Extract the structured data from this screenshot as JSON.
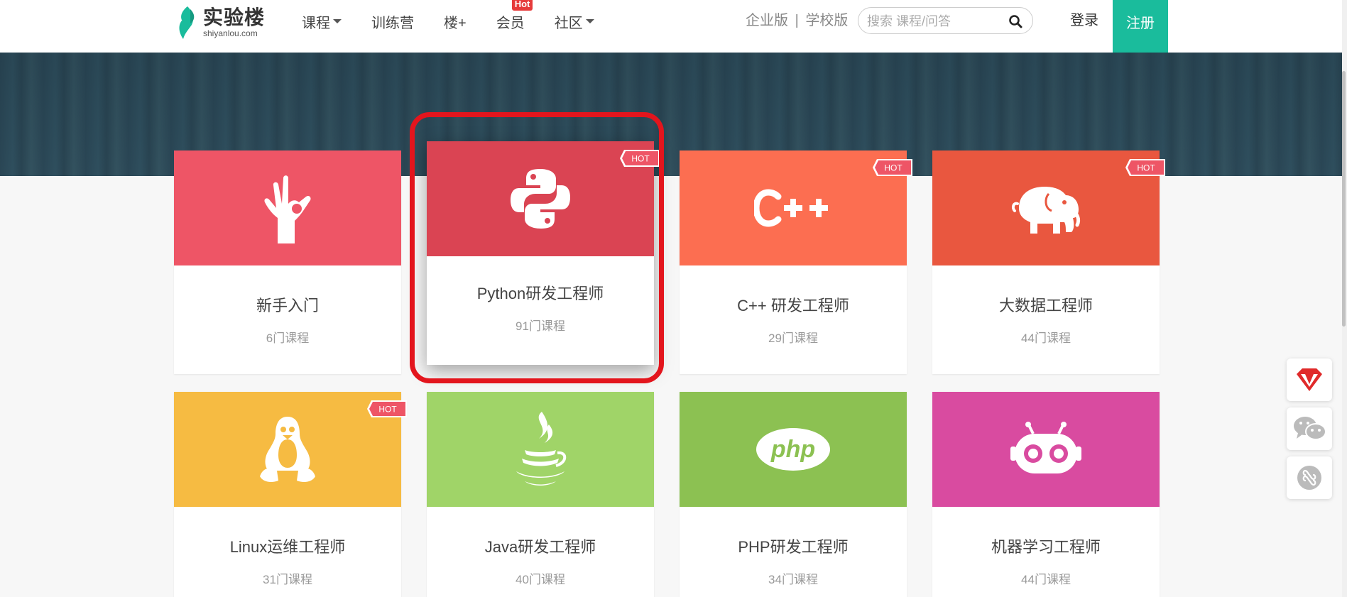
{
  "header": {
    "logo": {
      "cn": "实验楼",
      "en": "shiyanlou.com"
    },
    "nav": [
      {
        "label": "课程",
        "dropdown": true
      },
      {
        "label": "训练营",
        "dropdown": false
      },
      {
        "label": "楼+",
        "dropdown": false
      },
      {
        "label": "会员",
        "dropdown": false,
        "badge": "Hot"
      },
      {
        "label": "社区",
        "dropdown": true
      }
    ],
    "enterprise": "企业版",
    "separator": "|",
    "school": "学校版",
    "search_placeholder": "搜索 课程/问答",
    "login": "登录",
    "register": "注册"
  },
  "cards": [
    {
      "title": "新手入门",
      "count": "6门课程",
      "color": "#ee5566",
      "icon": "ok-hand-icon",
      "hot": false
    },
    {
      "title": "Python研发工程师",
      "count": "91门课程",
      "color": "#da4453",
      "icon": "python-icon",
      "hot": true,
      "highlighted": true
    },
    {
      "title": "C++ 研发工程师",
      "count": "29门课程",
      "color": "#fc6e51",
      "icon": "cpp-icon",
      "hot": true
    },
    {
      "title": "大数据工程师",
      "count": "44门课程",
      "color": "#e9573f",
      "icon": "hadoop-elephant-icon",
      "hot": true
    },
    {
      "title": "Linux运维工程师",
      "count": "31门课程",
      "color": "#f6bb42",
      "icon": "linux-penguin-icon",
      "hot": true
    },
    {
      "title": "Java研发工程师",
      "count": "40门课程",
      "color": "#a0d468",
      "icon": "java-cup-icon",
      "hot": false
    },
    {
      "title": "PHP研发工程师",
      "count": "34门课程",
      "color": "#8cc152",
      "icon": "php-icon",
      "hot": false
    },
    {
      "title": "机器学习工程师",
      "count": "44门课程",
      "color": "#d94ba0",
      "icon": "robot-icon",
      "hot": false
    }
  ],
  "hot_label": "HOT",
  "float_tools": [
    "vip-gem-icon",
    "wechat-icon",
    "mini-program-icon"
  ],
  "colors": {
    "accent": "#1abc9c",
    "highlight": "#e3151d",
    "hot_badge": "#e63b3b"
  }
}
